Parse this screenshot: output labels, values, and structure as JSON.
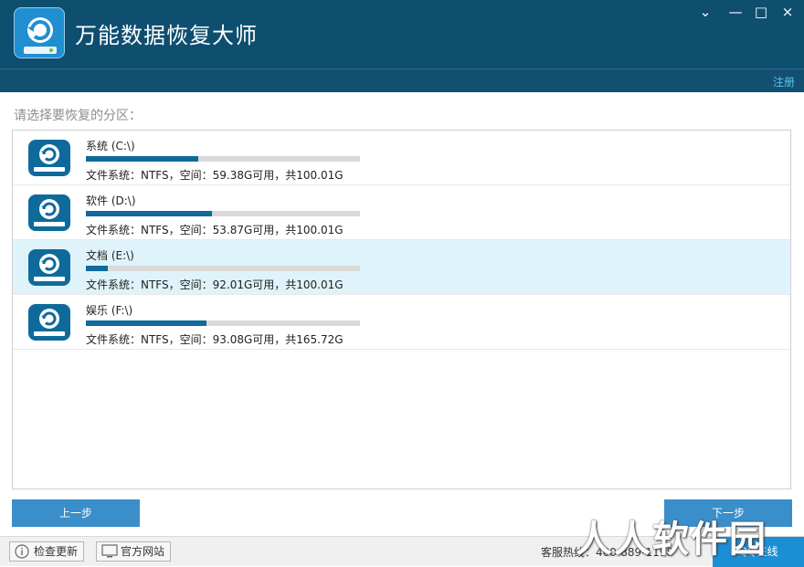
{
  "app": {
    "title": "万能数据恢复大师",
    "register": "注册"
  },
  "window_controls": {
    "dropdown": "⌄",
    "minimize": "—",
    "maximize": "□",
    "close": "×"
  },
  "prompt": "请选择要恢复的分区：",
  "partitions": [
    {
      "name": "系统 (C:\\)",
      "usage_fraction": 0.41,
      "info": "文件系统：NTFS，空间：59.38G可用，共100.01G",
      "selected": false
    },
    {
      "name": "软件 (D:\\)",
      "usage_fraction": 0.46,
      "info": "文件系统：NTFS，空间：53.87G可用，共100.01G",
      "selected": false
    },
    {
      "name": "文档 (E:\\)",
      "usage_fraction": 0.08,
      "info": "文件系统：NTFS，空间：92.01G可用，共100.01G",
      "selected": true
    },
    {
      "name": "娱乐 (F:\\)",
      "usage_fraction": 0.44,
      "info": "文件系统：NTFS，空间：93.08G可用，共165.72G",
      "selected": false
    }
  ],
  "buttons": {
    "prev": "上一步",
    "next": "下一步"
  },
  "footer": {
    "check_update": "检查更新",
    "official_site": "官方网站",
    "hotline": "客服热线：400-889-1198",
    "qq": "QQ在线"
  },
  "watermark": "人人软件园",
  "colors": {
    "titlebar": "#0e4f70",
    "accent": "#3a8ec9",
    "selected_row": "#dff3fb",
    "bar_fill": "#0f6a9c"
  }
}
